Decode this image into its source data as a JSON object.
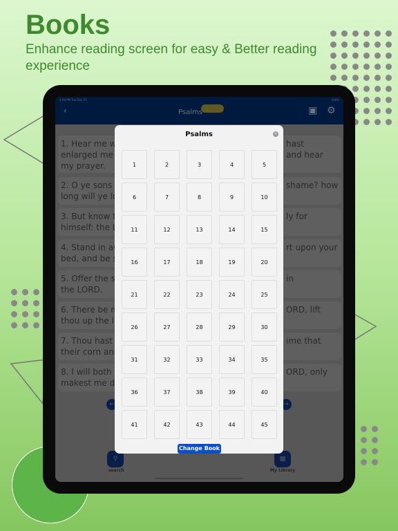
{
  "promo": {
    "title": "Books",
    "subtitle": "Enhance reading screen for easy & Better reading experience"
  },
  "status": {
    "time": "3:09 PM  Tue Dec 27",
    "battery": "100%"
  },
  "header": {
    "title": "Psalms",
    "chapter_badge": "4"
  },
  "verses": [
    {
      "left": "1. Hear me wh",
      "right": "hast",
      "left2": "enlarged me w",
      "right2": "and hear",
      "left3": "my prayer."
    },
    {
      "left": "2. O ye sons",
      "right": "shame? how",
      "left2": "long will ye lo"
    },
    {
      "left": "3. But know th",
      "right": "ly for",
      "left2": "himself: the LO"
    },
    {
      "left": "4. Stand in aw",
      "right": "rt upon your",
      "left2": "bed, and be st"
    },
    {
      "left": "5. Offer the sa",
      "right": "in",
      "left2": "the LORD."
    },
    {
      "left": "6. There be m",
      "right": "ORD, lift",
      "left2": "thou up the lig"
    },
    {
      "left": "7. Thou hast p",
      "right": "ime that",
      "left2": "their corn and"
    },
    {
      "left": "8. I will both l",
      "right": "ORD, only",
      "left2": "makest me dw"
    }
  ],
  "tabs": {
    "search": "search",
    "library": "My Library"
  },
  "modal": {
    "title": "Psalms",
    "chapters": [
      "1",
      "2",
      "3",
      "4",
      "5",
      "6",
      "7",
      "8",
      "9",
      "10",
      "11",
      "12",
      "13",
      "14",
      "15",
      "16",
      "17",
      "18",
      "19",
      "20",
      "21",
      "22",
      "23",
      "24",
      "25",
      "26",
      "27",
      "28",
      "29",
      "30",
      "31",
      "32",
      "33",
      "34",
      "35",
      "36",
      "37",
      "38",
      "39",
      "40",
      "41",
      "42",
      "43",
      "44",
      "45"
    ],
    "change_book": "Change Book"
  },
  "colors": {
    "accent": "#0b4fc8",
    "header": "#001a3f",
    "brand_green": "#3f8a2e"
  }
}
